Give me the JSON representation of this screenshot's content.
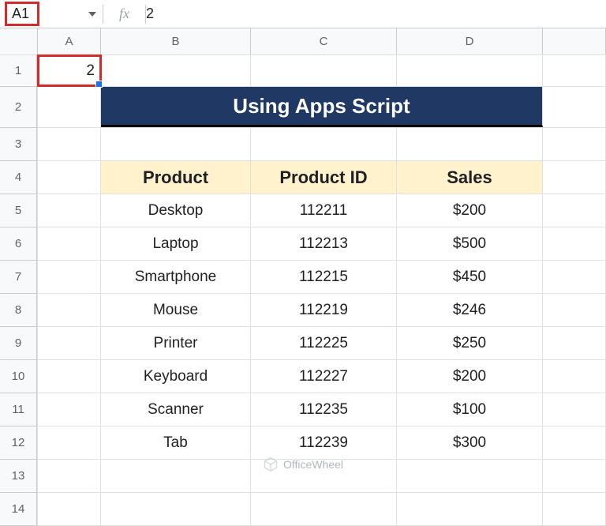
{
  "formula_bar": {
    "cell_reference": "A1",
    "fx_label": "fx",
    "formula_value": "2"
  },
  "columns": [
    "A",
    "B",
    "C",
    "D"
  ],
  "rows": [
    "1",
    "2",
    "3",
    "4",
    "5",
    "6",
    "7",
    "8",
    "9",
    "10",
    "11",
    "12",
    "13",
    "14"
  ],
  "cells": {
    "A1": "2",
    "title": "Using Apps Script",
    "headers": {
      "product": "Product",
      "product_id": "Product ID",
      "sales": "Sales"
    }
  },
  "chart_data": {
    "type": "table",
    "title": "Using Apps Script",
    "columns": [
      "Product",
      "Product ID",
      "Sales"
    ],
    "rows": [
      {
        "product": "Desktop",
        "product_id": "112211",
        "sales": "$200"
      },
      {
        "product": "Laptop",
        "product_id": "112213",
        "sales": "$500"
      },
      {
        "product": "Smartphone",
        "product_id": "112215",
        "sales": "$450"
      },
      {
        "product": "Mouse",
        "product_id": "112219",
        "sales": "$246"
      },
      {
        "product": "Printer",
        "product_id": "112225",
        "sales": "$250"
      },
      {
        "product": "Keyboard",
        "product_id": "112227",
        "sales": "$200"
      },
      {
        "product": "Scanner",
        "product_id": "112235",
        "sales": "$100"
      },
      {
        "product": "Tab",
        "product_id": "112239",
        "sales": "$300"
      }
    ]
  },
  "watermark": "OfficeWheel"
}
